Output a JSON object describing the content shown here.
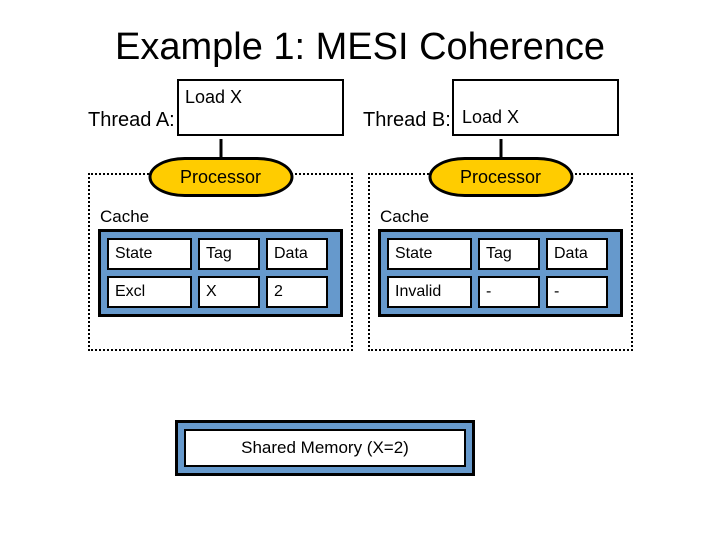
{
  "title": "Example 1: MESI Coherence",
  "thread_a": {
    "label": "Thread A:",
    "op": "Load X"
  },
  "thread_b": {
    "label": "Thread B:",
    "op": "Load X"
  },
  "processor_label": "Processor",
  "cache_label": "Cache",
  "columns": {
    "state": "State",
    "tag": "Tag",
    "data": "Data"
  },
  "cache_a": {
    "state": "Excl",
    "tag": "X",
    "data": "2"
  },
  "cache_b": {
    "state": "Invalid",
    "tag": "-",
    "data": "-"
  },
  "shared_memory": "Shared Memory (X=2)"
}
